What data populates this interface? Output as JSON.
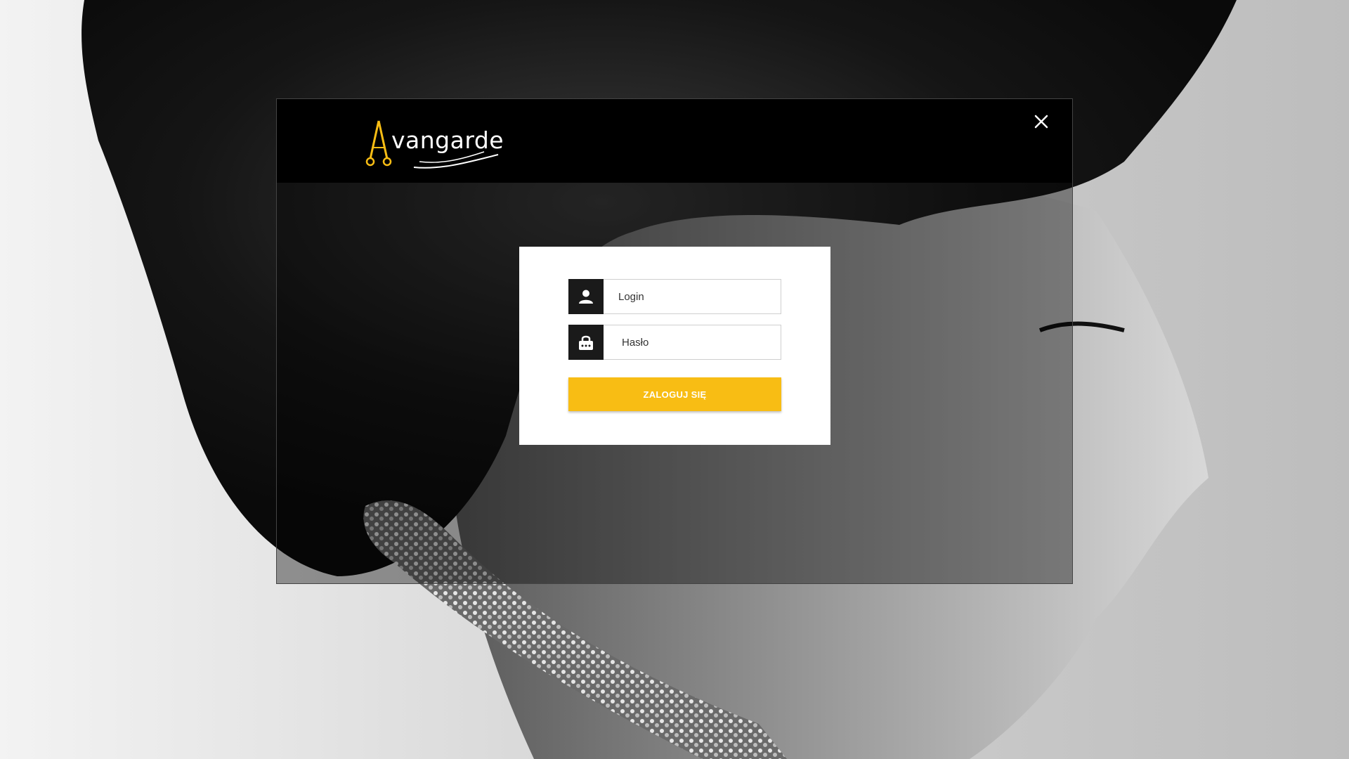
{
  "app": {
    "logo_text": "vangarde",
    "logo_accent_color": "#f8bd14"
  },
  "modal": {
    "close_icon": "close-icon"
  },
  "form": {
    "login_placeholder": "Login",
    "login_icon": "user-icon",
    "password_placeholder": "Hasło",
    "password_icon": "lock-icon",
    "submit_label": "ZALOGUJ SIĘ",
    "submit_color": "#f8bd14"
  }
}
